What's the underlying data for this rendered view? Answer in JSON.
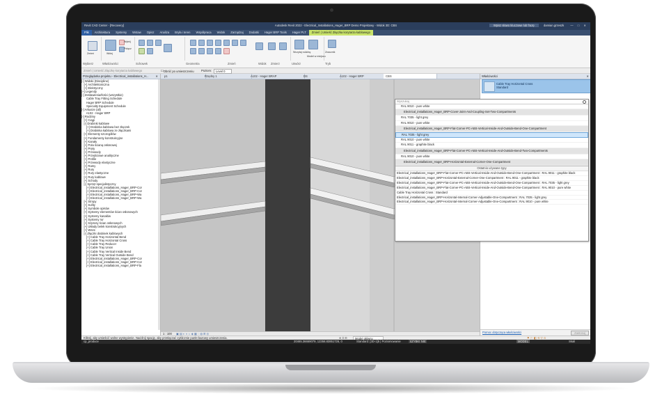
{
  "window": {
    "app_name": "Revit CAD Center - [Recovery]",
    "title": "Autodesk Revit 2022 - Electrical_Installations_Hager_BRP Demo Projektowy - Widok 3D: CBS",
    "search_hint": "Wpisz słowo kluczowe lub frazę",
    "user": "damian.grzeszk"
  },
  "ribbon_tabs": [
    "Plik",
    "Architektura",
    "Systemy",
    "Wstaw",
    "Opisz",
    "Analiza",
    "Bryła i teren",
    "Współpraca",
    "Widok",
    "Zarządzaj",
    "Dodatki",
    "Hager BRP Tools",
    "Hager PLT"
  ],
  "ribbon_context_tab": "Zmień | Umieść Złączka korytarza kablowego",
  "ribbon_groups": [
    "Wybierz",
    "Właściwości",
    "Schowek",
    "Geometria",
    "Zmień",
    "Widok",
    "Zmierz",
    "Utwórz",
    "Tryb"
  ],
  "ribbon_buttons": {
    "modify": "Zmień",
    "paste": "Wklej",
    "cut": "Wytnij",
    "join": "Połącz",
    "load_family": "Wczytaj rodzinę",
    "model_family": "Model w miejscu",
    "tag": "Znacznik"
  },
  "options_bar": {
    "left": "Zmień | Umieść Złączkę korytarza kablowego",
    "rotate_label": "Obróć po umieszczeniu",
    "level_label": "Poziom:",
    "level_value": "Level 0"
  },
  "project_browser": {
    "header": "Przeglądarka projektu - Electrical_installations_H...",
    "items": [
      "[-] Widoki (Discipline)",
      "   [+] Architektoniczna",
      "   [+] Elektryczny",
      "[+] Legendy",
      "[-] Zestawienia/Ilości (wszystkie)",
      "      Cable Tray Fitting Schedule",
      "      Hager BRP Schedule",
      "      Specialty Equipment Schedule",
      "[-] Arkusze (all)",
      "      A102 - Hager BRP",
      "[-] Rodziny",
      "   [+] Ciągi",
      "   [-] Drabinki kablowe",
      "      [+] Drabinka kablowa bez złączek",
      "      [+] Drabinka kablowa ze złączkami",
      "   [+] Elementy szczegółów",
      "   [+] Fundamenty konstrukcyjne",
      "   [+] Kanały",
      "   [+] Pola ścianą osłonowej",
      "   [+] Pręty",
      "   [+] Przewody",
      "   [+] Przejściowe analityczne",
      "   [+] Profile",
      "   [+] Przewody elastyczne",
      "   [+] Ramy",
      "   [+] Rury",
      "   [+] Rury elastyczne",
      "   [+] Rury kablowe",
      "   [+] Schody",
      "   [-] Sprzęt specjalistyczny",
      "      [+] Electrical_installations_Hager_BRP-Cor",
      "      [+] Electrical_installations_Hager_BRP-Cor",
      "      [+] Electrical_installations_Hager_BRP-Wa",
      "      [+] Electrical_installations_Hager_BRP-Wa",
      "   [+] Stropy",
      "   [+] Sufity",
      "   [+] Symbole opisów",
      "   [+] Systemy elementów ścian osłonowych",
      "   [+] Systemy kanałów",
      "   [+] Systemy rur",
      "   [+] Szprosy ścian osłonowych",
      "   [+] Układy belek konstrukcyjnych",
      "   [+] Wsze",
      "   [-] Złączki drabinek kablowych",
      "      [+] Cable Tray Horizontal Bend",
      "      [+] Cable Tray Horizontal Cross",
      "      [+] Cable Tray Reducer",
      "      [+] Cable Tray Union",
      "      [+] Cable Tray Vertical Inside Bend",
      "      [+] Cable Tray Vertical Outside Bend",
      "      [+] Electrical_installations_Hager_BRP-Cor",
      "      [+] Electrical_installations_Hager_BRP-Cor",
      "      [+] Electrical_installations_Hager_BRP-Fla"
    ]
  },
  "view_tabs": [
    "p1",
    "Rzędny 1",
    "A102 - Hager BRAP",
    "DS",
    "A102 - Hager BRP",
    "CBS"
  ],
  "properties": {
    "header": "Właściwości",
    "type_name": "Cable Tray Horizontal Cross",
    "type_sub": "Standard",
    "help_link": "Pomoc dotycząca właściwości",
    "apply": "Zastosuj"
  },
  "dropdown": {
    "search_placeholder": "Wyszukaj",
    "items": [
      {
        "text": "RAL 9010 - pure white",
        "kind": "type"
      },
      {
        "text": "Electrical_installations_Hager_BRP-Cover-Joint-And-Coupling-Set-Two-Compartments",
        "kind": "family"
      },
      {
        "text": "RAL 7035 - light grey",
        "kind": "type"
      },
      {
        "text": "RAL 9010 - pure white",
        "kind": "type"
      },
      {
        "text": "Electrical_installations_Hager_BRP-Flat-Corner-PC-ABS-Vertical-Inside-And-Outside-Bend-One-Compartment",
        "kind": "family"
      },
      {
        "text": "RAL 7035 - light grey",
        "kind": "selected"
      },
      {
        "text": "RAL 9010 - pure white",
        "kind": "type"
      },
      {
        "text": "RAL 9011 - graphite black",
        "kind": "type"
      },
      {
        "text": "Electrical_installations_Hager_BRP-Flat-Corner-PC-ABS-Vertical-Inside-And-Outside-Bend-Two-Compartments",
        "kind": "family"
      },
      {
        "text": "RAL 9010 - pure white",
        "kind": "type"
      },
      {
        "text": "Electrical_installations_Hager_BRP-Horizontal-External-Corner-One-Compartment",
        "kind": "family"
      }
    ],
    "recent_header": "Ostatnio używane typy",
    "recent": [
      "Electrical_installations_Hager_BRP-Flat-Corner-PC-ABS-Vertical-Inside-And-Outside-Bend-One-Compartment : RAL 9011 - graphite black",
      "Electrical_installations_Hager_BRP-Horizontal-External-Corner-One-Compartment : RAL 9011 - graphite black",
      "Electrical_installations_Hager_BRP-Flat-Corner-PC-ABS-Vertical-Inside-And-Outside-Bend-One-Compartment : RAL 7035 - light grey",
      "Electrical_installations_Hager_BRP-Flat-Corner-PC-ABS-Vertical-Inside-And-Outside-Bend-One-Compartment : RAL 9010 - pure white",
      "Cable Tray Horizontal Cross : Standard",
      "Electrical_installations_Hager_BRP-Horizontal-Internal-Corner-Adjustable-One-Compartment : RAL 7035 - light grey",
      "Electrical_installations_Hager_BRP-Horizontal-Internal-Corner-Adjustable-One-Compartment : RAL 9010 - pure white"
    ]
  },
  "view_control_bar": {
    "scale": "1 : 100"
  },
  "status": {
    "left": "Kliknij, aby umieścić wolne występienie. Naciśnij spację, aby przełączać cyklicznie punkt bazowy umieszczenia.",
    "model": "Model główny",
    "coords": "20465.36669079, 12358.83851726, 0",
    "standard": "Standard: [3D-1]5 | Poziomowanie",
    "mode": "MODEL",
    "scale_mode": "Skali"
  },
  "cmd": {
    "line": "cp_produce"
  },
  "colors": {
    "accent": "#2b3e5c",
    "context_tab": "#c9e36b",
    "selection": "#cfe6fb",
    "type_selector": "#9bc4ea"
  }
}
